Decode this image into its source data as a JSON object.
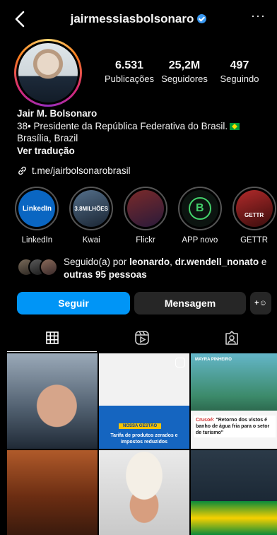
{
  "header": {
    "username": "jairmessiasbolsonaro",
    "verified_icon": "verified-badge-icon",
    "back_icon": "chevron-left-icon",
    "more_label": "···"
  },
  "stats": [
    {
      "value": "6.531",
      "label": "Publicações"
    },
    {
      "value": "25,2M",
      "label": "Seguidores"
    },
    {
      "value": "497",
      "label": "Seguindo"
    }
  ],
  "bio": {
    "name": "Jair M. Bolsonaro",
    "line1": "38• Presidente da República Federativa do Brasil.",
    "line2": "Brasília, Brazil",
    "translate": "Ver tradução",
    "link": "t.me/jairbolsonarobrasil"
  },
  "highlights": [
    {
      "label": "LinkedIn",
      "thumb_text": "LinkedIn"
    },
    {
      "label": "Kwai",
      "thumb_text": "3.8MILHÕES"
    },
    {
      "label": "Flickr",
      "thumb_text": ""
    },
    {
      "label": "APP novo",
      "thumb_text": "B"
    },
    {
      "label": "GETTR",
      "thumb_text": "GETTR"
    }
  ],
  "followed_by": {
    "prefix": "Seguido(a) por",
    "user1": "leonardo",
    "user2": "dr.wendell_nonato",
    "suffix": "e",
    "others": "outras 95 pessoas"
  },
  "actions": {
    "follow": "Seguir",
    "message": "Mensagem",
    "add_user": "+☺"
  },
  "tabs": [
    {
      "name": "posts",
      "icon": "grid-icon",
      "active": true
    },
    {
      "name": "reels",
      "icon": "reels-icon",
      "active": false
    },
    {
      "name": "tagged",
      "icon": "tagged-icon",
      "active": false
    }
  ],
  "posts": {
    "p2_tag": "NOSSA GESTÃO",
    "p2_caption": "Tarifa de produtos zerados e impostos reduzidos",
    "p3_logo": "MAYRA PINHEIRO",
    "p3_caption_red": "Crusoé:",
    "p3_caption": "\"Retorno dos vistos é banho de água fria para o setor de turismo\""
  },
  "colors": {
    "background": "#000000",
    "primary_button": "#0095f6",
    "secondary_button": "#262626",
    "verified": "#3897f0"
  }
}
